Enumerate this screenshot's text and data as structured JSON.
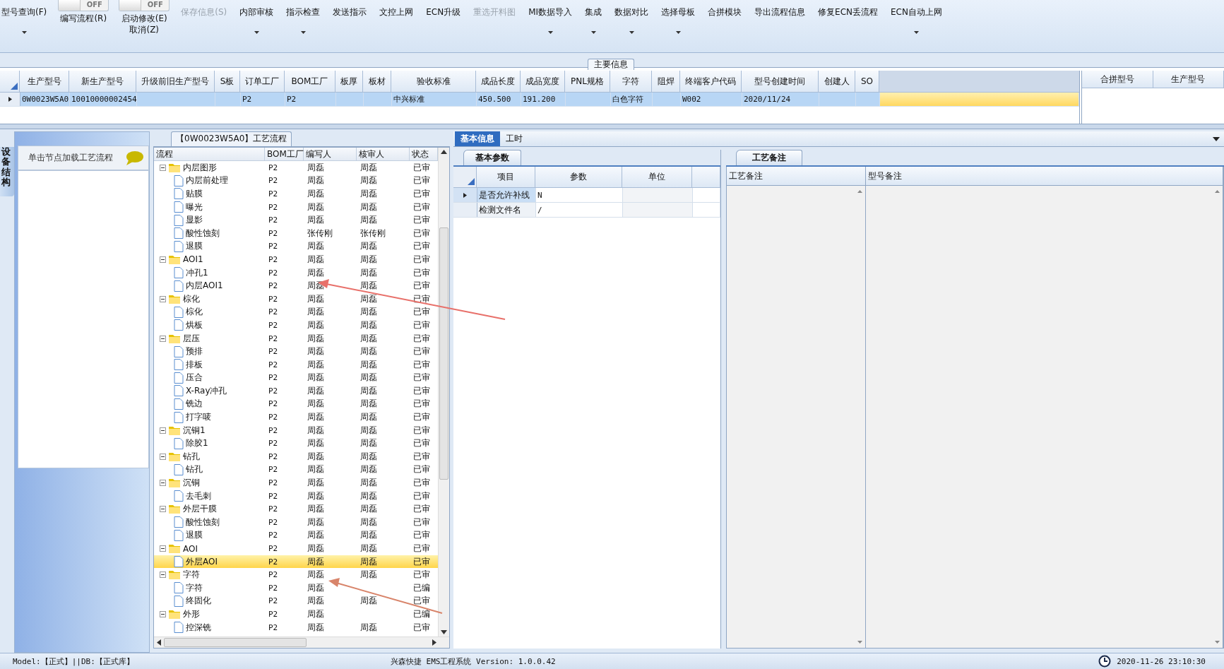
{
  "toolbar": [
    {
      "kind": "button",
      "label": "型号查询(F)",
      "dropdown": true,
      "disabled": false
    },
    {
      "kind": "toggle",
      "toggle_label": "OFF",
      "on": false,
      "label": "编写流程(R)",
      "dropdown": false,
      "disabled": false
    },
    {
      "kind": "toggle",
      "toggle_label": "OFF",
      "on": false,
      "label": "启动修改(E)",
      "sublabel": "取消(Z)",
      "dropdown": false,
      "disabled": false
    },
    {
      "kind": "button",
      "label": "保存信息(S)",
      "dropdown": false,
      "disabled": true
    },
    {
      "kind": "button",
      "label": "内部审核",
      "dropdown": true,
      "disabled": false
    },
    {
      "kind": "button",
      "label": "指示检查",
      "dropdown": true,
      "disabled": false
    },
    {
      "kind": "button",
      "label": "发送指示",
      "dropdown": false,
      "disabled": false
    },
    {
      "kind": "button",
      "label": "文控上网",
      "dropdown": false,
      "disabled": false
    },
    {
      "kind": "button",
      "label": "ECN升级",
      "dropdown": false,
      "disabled": false
    },
    {
      "kind": "button",
      "label": "重选开料图",
      "dropdown": false,
      "disabled": true
    },
    {
      "kind": "button",
      "label": "MI数据导入",
      "dropdown": true,
      "disabled": false
    },
    {
      "kind": "button",
      "label": "集成",
      "dropdown": true,
      "disabled": false
    },
    {
      "kind": "button",
      "label": "数据对比",
      "dropdown": true,
      "disabled": false
    },
    {
      "kind": "button",
      "label": "选择母板",
      "dropdown": true,
      "disabled": false
    },
    {
      "kind": "button",
      "label": "合拼模块",
      "dropdown": false,
      "disabled": false
    },
    {
      "kind": "button",
      "label": "导出流程信息",
      "dropdown": false,
      "disabled": false
    },
    {
      "kind": "button",
      "label": "修复ECN丢流程",
      "dropdown": false,
      "disabled": false
    },
    {
      "kind": "button",
      "label": "ECN自动上网",
      "dropdown": true,
      "disabled": false
    }
  ],
  "main_info": {
    "title": "主要信息",
    "columns": [
      "生产型号",
      "新生产型号",
      "升级前旧生产型号",
      "S板",
      "订单工厂",
      "BOM工厂",
      "板厚",
      "板材",
      "验收标准",
      "成品长度",
      "成品宽度",
      "PNL规格",
      "字符",
      "阻焊",
      "终端客户代码",
      "型号创建时间",
      "创建人",
      "SO"
    ],
    "rows": [
      {
        "selected": true,
        "cells": [
          "0W0023W5A0",
          "10010000002454",
          null,
          null,
          "P2",
          "P2",
          null,
          null,
          "中兴标准",
          "450.500",
          "191.200",
          null,
          "白色字符",
          null,
          "W002",
          "2020/11/24",
          null,
          null
        ]
      }
    ],
    "merge_columns": [
      "合拼型号",
      "生产型号"
    ]
  },
  "side_panel": {
    "tab": "设备结构",
    "hint": "单击节点加载工艺流程"
  },
  "process_tree": {
    "title": "【0W0023W5A0】工艺流程",
    "columns": [
      "流程",
      "BOM工厂",
      "编写人",
      "核审人",
      "状态"
    ],
    "nodes": [
      {
        "name": "内层图形",
        "bom": "P2",
        "writer": "周磊",
        "reviewer": "周磊",
        "status": "已审",
        "selected": false,
        "expanded": true,
        "children": [
          {
            "name": "内层前处理",
            "bom": "P2",
            "writer": "周磊",
            "reviewer": "周磊",
            "status": "已审",
            "selected": false
          },
          {
            "name": "贴膜",
            "bom": "P2",
            "writer": "周磊",
            "reviewer": "周磊",
            "status": "已审",
            "selected": false
          },
          {
            "name": "曝光",
            "bom": "P2",
            "writer": "周磊",
            "reviewer": "周磊",
            "status": "已审",
            "selected": false
          },
          {
            "name": "显影",
            "bom": "P2",
            "writer": "周磊",
            "reviewer": "周磊",
            "status": "已审",
            "selected": false
          },
          {
            "name": "酸性蚀刻",
            "bom": "P2",
            "writer": "张传刚",
            "reviewer": "张传刚",
            "status": "已审",
            "selected": false
          },
          {
            "name": "退膜",
            "bom": "P2",
            "writer": "周磊",
            "reviewer": "周磊",
            "status": "已审",
            "selected": false
          }
        ]
      },
      {
        "name": "AOI1",
        "bom": "P2",
        "writer": "周磊",
        "reviewer": "周磊",
        "status": "已审",
        "selected": false,
        "expanded": true,
        "children": [
          {
            "name": "冲孔1",
            "bom": "P2",
            "writer": "周磊",
            "reviewer": "周磊",
            "status": "已审",
            "selected": false
          },
          {
            "name": "内层AOI1",
            "bom": "P2",
            "writer": "周磊",
            "reviewer": "周磊",
            "status": "已审",
            "selected": false
          }
        ]
      },
      {
        "name": "棕化",
        "bom": "P2",
        "writer": "周磊",
        "reviewer": "周磊",
        "status": "已审",
        "selected": false,
        "expanded": true,
        "children": [
          {
            "name": "棕化",
            "bom": "P2",
            "writer": "周磊",
            "reviewer": "周磊",
            "status": "已审",
            "selected": false
          },
          {
            "name": "烘板",
            "bom": "P2",
            "writer": "周磊",
            "reviewer": "周磊",
            "status": "已审",
            "selected": false
          }
        ]
      },
      {
        "name": "层压",
        "bom": "P2",
        "writer": "周磊",
        "reviewer": "周磊",
        "status": "已审",
        "selected": false,
        "expanded": true,
        "children": [
          {
            "name": "预排",
            "bom": "P2",
            "writer": "周磊",
            "reviewer": "周磊",
            "status": "已审",
            "selected": false
          },
          {
            "name": "排板",
            "bom": "P2",
            "writer": "周磊",
            "reviewer": "周磊",
            "status": "已审",
            "selected": false
          },
          {
            "name": "压合",
            "bom": "P2",
            "writer": "周磊",
            "reviewer": "周磊",
            "status": "已审",
            "selected": false
          },
          {
            "name": "X-Ray冲孔",
            "bom": "P2",
            "writer": "周磊",
            "reviewer": "周磊",
            "status": "已审",
            "selected": false
          },
          {
            "name": "铣边",
            "bom": "P2",
            "writer": "周磊",
            "reviewer": "周磊",
            "status": "已审",
            "selected": false
          },
          {
            "name": "打字唛",
            "bom": "P2",
            "writer": "周磊",
            "reviewer": "周磊",
            "status": "已审",
            "selected": false
          }
        ]
      },
      {
        "name": "沉铜1",
        "bom": "P2",
        "writer": "周磊",
        "reviewer": "周磊",
        "status": "已审",
        "selected": false,
        "expanded": true,
        "children": [
          {
            "name": "除胶1",
            "bom": "P2",
            "writer": "周磊",
            "reviewer": "周磊",
            "status": "已审",
            "selected": false
          }
        ]
      },
      {
        "name": "钻孔",
        "bom": "P2",
        "writer": "周磊",
        "reviewer": "周磊",
        "status": "已审",
        "selected": false,
        "expanded": true,
        "children": [
          {
            "name": "钻孔",
            "bom": "P2",
            "writer": "周磊",
            "reviewer": "周磊",
            "status": "已审",
            "selected": false
          }
        ]
      },
      {
        "name": "沉铜",
        "bom": "P2",
        "writer": "周磊",
        "reviewer": "周磊",
        "status": "已审",
        "selected": false,
        "expanded": true,
        "children": [
          {
            "name": "去毛刺",
            "bom": "P2",
            "writer": "周磊",
            "reviewer": "周磊",
            "status": "已审",
            "selected": false
          }
        ]
      },
      {
        "name": "外层干膜",
        "bom": "P2",
        "writer": "周磊",
        "reviewer": "周磊",
        "status": "已审",
        "selected": false,
        "expanded": true,
        "children": [
          {
            "name": "酸性蚀刻",
            "bom": "P2",
            "writer": "周磊",
            "reviewer": "周磊",
            "status": "已审",
            "selected": false
          },
          {
            "name": "退膜",
            "bom": "P2",
            "writer": "周磊",
            "reviewer": "周磊",
            "status": "已审",
            "selected": false
          }
        ]
      },
      {
        "name": "AOI",
        "bom": "P2",
        "writer": "周磊",
        "reviewer": "周磊",
        "status": "已审",
        "selected": false,
        "expanded": true,
        "children": [
          {
            "name": "外层AOI",
            "bom": "P2",
            "writer": "周磊",
            "reviewer": "周磊",
            "status": "已审",
            "selected": true
          }
        ]
      },
      {
        "name": "字符",
        "bom": "P2",
        "writer": "周磊",
        "reviewer": "周磊",
        "status": "已审",
        "selected": false,
        "expanded": true,
        "children": [
          {
            "name": "字符",
            "bom": "P2",
            "writer": "周磊",
            "status": "已编",
            "selected": false
          },
          {
            "name": "终固化",
            "bom": "P2",
            "writer": "周磊",
            "reviewer": "周磊",
            "status": "已审",
            "selected": false
          }
        ]
      },
      {
        "name": "外形",
        "bom": "P2",
        "writer": "周磊",
        "status": "已编",
        "selected": false,
        "expanded": true,
        "children": [
          {
            "name": "控深铣",
            "bom": "P2",
            "writer": "周磊",
            "reviewer": "周磊",
            "status": "已审",
            "selected": false
          }
        ]
      }
    ]
  },
  "detail": {
    "tabs": [
      {
        "label": "基本信息",
        "selected": true
      },
      {
        "label": "工时",
        "selected": false
      }
    ],
    "params": {
      "tab": "基本参数",
      "columns": [
        "项目",
        "参数",
        "单位"
      ],
      "rows": [
        {
          "item": "是否允许补线",
          "value": "N",
          "selected": true
        },
        {
          "item": "检测文件名",
          "value": "/",
          "selected": false
        }
      ]
    },
    "notes": {
      "tab": "工艺备注",
      "columns": [
        "工艺备注",
        "型号备注"
      ]
    }
  },
  "status_bar": {
    "left": "Model:【正式】||DB:【正式库】",
    "center": "兴森快捷 EMS工程系统 Version: 1.0.0.42",
    "time": "2020-11-26 23:10:30"
  }
}
